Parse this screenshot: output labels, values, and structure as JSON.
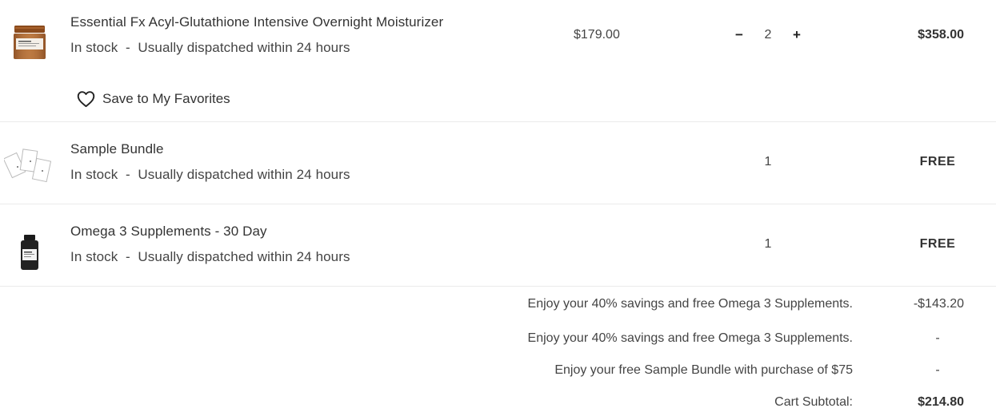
{
  "items": [
    {
      "name": "Essential Fx Acyl-Glutathione Intensive Overnight Moisturizer",
      "stock": "In stock  -  Usually dispatched within 24 hours",
      "unit_price": "$179.00",
      "qty": "2",
      "qty_minus": "−",
      "qty_plus": "+",
      "total": "$358.00",
      "thumb_icon": "moisturizer-jar"
    },
    {
      "name": "Sample Bundle",
      "stock": "In stock  -  Usually dispatched within 24 hours",
      "qty": "1",
      "total": "FREE",
      "thumb_icon": "sample-packets"
    },
    {
      "name": "Omega 3 Supplements - 30 Day",
      "stock": "In stock  -  Usually dispatched within 24 hours",
      "qty": "1",
      "total": "FREE",
      "thumb_icon": "supplement-bottle"
    }
  ],
  "favorites": {
    "label": "Save to My Favorites",
    "icon": "heart-icon"
  },
  "summary": [
    {
      "label": "Enjoy your 40% savings and free Omega 3 Supplements.",
      "value": "-$143.20"
    },
    {
      "label": "Enjoy your 40% savings and free Omega 3 Supplements.",
      "value": "-"
    },
    {
      "label": "Enjoy your free Sample Bundle with purchase of $75",
      "value": "-"
    }
  ],
  "subtotal": {
    "label": "Cart Subtotal:",
    "value": "$214.80"
  }
}
